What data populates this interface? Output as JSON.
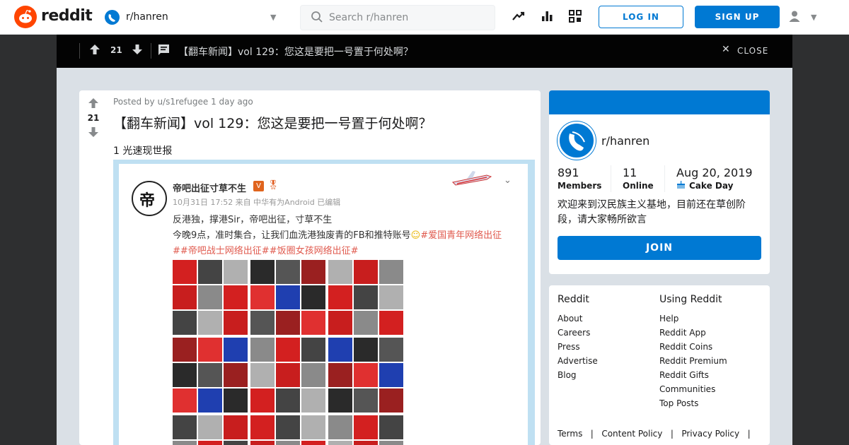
{
  "header": {
    "logo_text": "reddit",
    "subreddit": "r/hanren",
    "search_placeholder": "Search r/hanren",
    "login_label": "LOG IN",
    "signup_label": "SIGN UP"
  },
  "topbar": {
    "score": "21",
    "title": "【翻车新闻】vol 129：您这是要把一号置于何处啊？",
    "close_label": "CLOSE"
  },
  "post": {
    "score": "21",
    "meta": "Posted by u/s1refugee 1 day ago",
    "title": "【翻车新闻】vol 129：您这是要把一号置于何处啊？",
    "flair": "1 光速现世报"
  },
  "embed": {
    "name": "帝吧出征寸草不生",
    "avatar_char": "帝",
    "verified": "V",
    "time": "10月31日 17:52 来自 中华有为Android  已编辑",
    "line1": "反港独，撑港Sir，帝吧出征，寸草不生",
    "line2": "今晚9点，准时集合，让我们血洗港独废青的FB和推特账号",
    "tag1": "#爱国青年网络出征",
    "tag2": "##帝吧战士网络出征##饭圈女孩网络出征#"
  },
  "sidebar": {
    "name": "r/hanren",
    "members_num": "891",
    "members_label": "Members",
    "online_num": "11",
    "online_label": "Online",
    "cake_date": "Aug 20, 2019",
    "cake_label": "Cake Day",
    "description": "欢迎来到汉民族主义基地，目前还在草创阶段，请大家畅所欲言",
    "join_label": "JOIN"
  },
  "footer": {
    "col1_head": "Reddit",
    "col1": [
      "About",
      "Careers",
      "Press",
      "Advertise",
      "Blog"
    ],
    "col2_head": "Using Reddit",
    "col2": [
      "Help",
      "Reddit App",
      "Reddit Coins",
      "Reddit Premium",
      "Reddit Gifts",
      "Communities",
      "Top Posts"
    ],
    "bottom": [
      "Terms",
      "Content Policy",
      "Privacy Policy"
    ]
  },
  "colors": {
    "brand": "#ff4500",
    "accent": "#0079d3",
    "topbar": "#030303",
    "frame": "#dae0e6"
  }
}
